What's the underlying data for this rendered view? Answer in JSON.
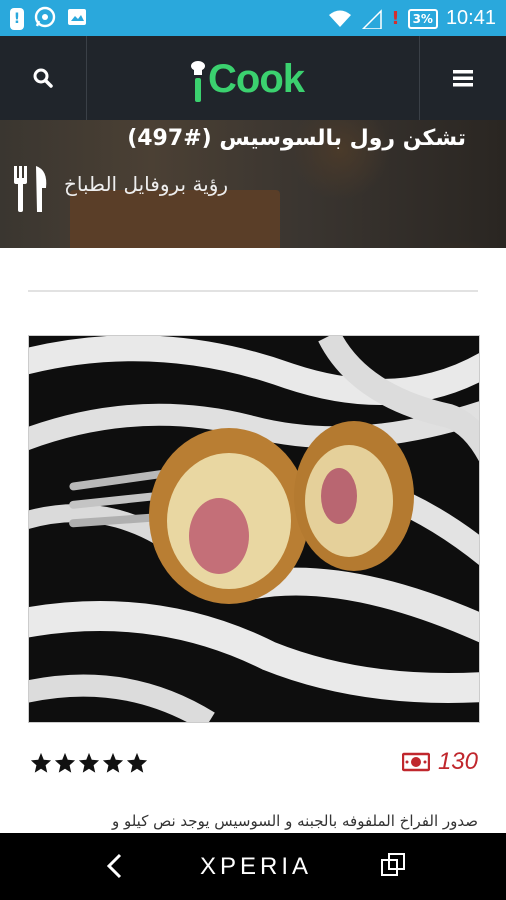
{
  "status_bar": {
    "time": "10:41",
    "battery": "3%",
    "notification_icons": [
      "sim-alert-icon",
      "whatsapp-icon",
      "gallery-icon"
    ],
    "alert_mark": "!"
  },
  "app_bar": {
    "logo_text": "Cook",
    "search_icon": "search-icon",
    "menu_icon": "hamburger-menu-icon",
    "brand_color": "#3bd16f",
    "bg_color": "#20252b"
  },
  "recipe": {
    "title": "تشكن رول بالسوسيس (#497)",
    "view_profile": "رؤية بروفايل الطباخ",
    "rating": 5,
    "price": "130",
    "description": "صدور الفراخ الملفوفه بالجبنه و السوسيس يوجد نص كيلو و"
  },
  "nav_bar": {
    "brand": "XPERIA"
  }
}
